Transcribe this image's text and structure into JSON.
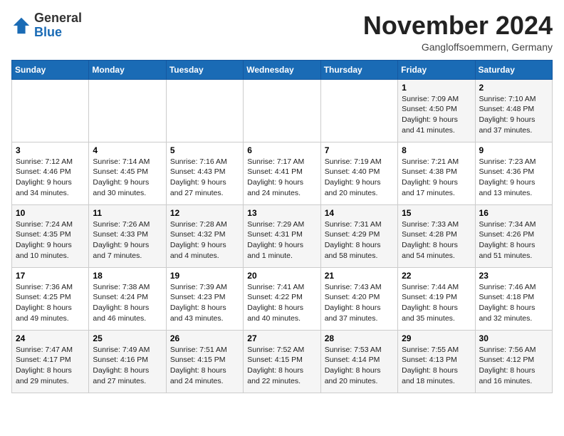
{
  "header": {
    "logo_general": "General",
    "logo_blue": "Blue",
    "month_title": "November 2024",
    "location": "Gangloffsoemmern, Germany"
  },
  "calendar": {
    "days_of_week": [
      "Sunday",
      "Monday",
      "Tuesday",
      "Wednesday",
      "Thursday",
      "Friday",
      "Saturday"
    ],
    "weeks": [
      [
        {
          "day": "",
          "info": ""
        },
        {
          "day": "",
          "info": ""
        },
        {
          "day": "",
          "info": ""
        },
        {
          "day": "",
          "info": ""
        },
        {
          "day": "",
          "info": ""
        },
        {
          "day": "1",
          "info": "Sunrise: 7:09 AM\nSunset: 4:50 PM\nDaylight: 9 hours\nand 41 minutes."
        },
        {
          "day": "2",
          "info": "Sunrise: 7:10 AM\nSunset: 4:48 PM\nDaylight: 9 hours\nand 37 minutes."
        }
      ],
      [
        {
          "day": "3",
          "info": "Sunrise: 7:12 AM\nSunset: 4:46 PM\nDaylight: 9 hours\nand 34 minutes."
        },
        {
          "day": "4",
          "info": "Sunrise: 7:14 AM\nSunset: 4:45 PM\nDaylight: 9 hours\nand 30 minutes."
        },
        {
          "day": "5",
          "info": "Sunrise: 7:16 AM\nSunset: 4:43 PM\nDaylight: 9 hours\nand 27 minutes."
        },
        {
          "day": "6",
          "info": "Sunrise: 7:17 AM\nSunset: 4:41 PM\nDaylight: 9 hours\nand 24 minutes."
        },
        {
          "day": "7",
          "info": "Sunrise: 7:19 AM\nSunset: 4:40 PM\nDaylight: 9 hours\nand 20 minutes."
        },
        {
          "day": "8",
          "info": "Sunrise: 7:21 AM\nSunset: 4:38 PM\nDaylight: 9 hours\nand 17 minutes."
        },
        {
          "day": "9",
          "info": "Sunrise: 7:23 AM\nSunset: 4:36 PM\nDaylight: 9 hours\nand 13 minutes."
        }
      ],
      [
        {
          "day": "10",
          "info": "Sunrise: 7:24 AM\nSunset: 4:35 PM\nDaylight: 9 hours\nand 10 minutes."
        },
        {
          "day": "11",
          "info": "Sunrise: 7:26 AM\nSunset: 4:33 PM\nDaylight: 9 hours\nand 7 minutes."
        },
        {
          "day": "12",
          "info": "Sunrise: 7:28 AM\nSunset: 4:32 PM\nDaylight: 9 hours\nand 4 minutes."
        },
        {
          "day": "13",
          "info": "Sunrise: 7:29 AM\nSunset: 4:31 PM\nDaylight: 9 hours\nand 1 minute."
        },
        {
          "day": "14",
          "info": "Sunrise: 7:31 AM\nSunset: 4:29 PM\nDaylight: 8 hours\nand 58 minutes."
        },
        {
          "day": "15",
          "info": "Sunrise: 7:33 AM\nSunset: 4:28 PM\nDaylight: 8 hours\nand 54 minutes."
        },
        {
          "day": "16",
          "info": "Sunrise: 7:34 AM\nSunset: 4:26 PM\nDaylight: 8 hours\nand 51 minutes."
        }
      ],
      [
        {
          "day": "17",
          "info": "Sunrise: 7:36 AM\nSunset: 4:25 PM\nDaylight: 8 hours\nand 49 minutes."
        },
        {
          "day": "18",
          "info": "Sunrise: 7:38 AM\nSunset: 4:24 PM\nDaylight: 8 hours\nand 46 minutes."
        },
        {
          "day": "19",
          "info": "Sunrise: 7:39 AM\nSunset: 4:23 PM\nDaylight: 8 hours\nand 43 minutes."
        },
        {
          "day": "20",
          "info": "Sunrise: 7:41 AM\nSunset: 4:22 PM\nDaylight: 8 hours\nand 40 minutes."
        },
        {
          "day": "21",
          "info": "Sunrise: 7:43 AM\nSunset: 4:20 PM\nDaylight: 8 hours\nand 37 minutes."
        },
        {
          "day": "22",
          "info": "Sunrise: 7:44 AM\nSunset: 4:19 PM\nDaylight: 8 hours\nand 35 minutes."
        },
        {
          "day": "23",
          "info": "Sunrise: 7:46 AM\nSunset: 4:18 PM\nDaylight: 8 hours\nand 32 minutes."
        }
      ],
      [
        {
          "day": "24",
          "info": "Sunrise: 7:47 AM\nSunset: 4:17 PM\nDaylight: 8 hours\nand 29 minutes."
        },
        {
          "day": "25",
          "info": "Sunrise: 7:49 AM\nSunset: 4:16 PM\nDaylight: 8 hours\nand 27 minutes."
        },
        {
          "day": "26",
          "info": "Sunrise: 7:51 AM\nSunset: 4:15 PM\nDaylight: 8 hours\nand 24 minutes."
        },
        {
          "day": "27",
          "info": "Sunrise: 7:52 AM\nSunset: 4:15 PM\nDaylight: 8 hours\nand 22 minutes."
        },
        {
          "day": "28",
          "info": "Sunrise: 7:53 AM\nSunset: 4:14 PM\nDaylight: 8 hours\nand 20 minutes."
        },
        {
          "day": "29",
          "info": "Sunrise: 7:55 AM\nSunset: 4:13 PM\nDaylight: 8 hours\nand 18 minutes."
        },
        {
          "day": "30",
          "info": "Sunrise: 7:56 AM\nSunset: 4:12 PM\nDaylight: 8 hours\nand 16 minutes."
        }
      ]
    ]
  }
}
